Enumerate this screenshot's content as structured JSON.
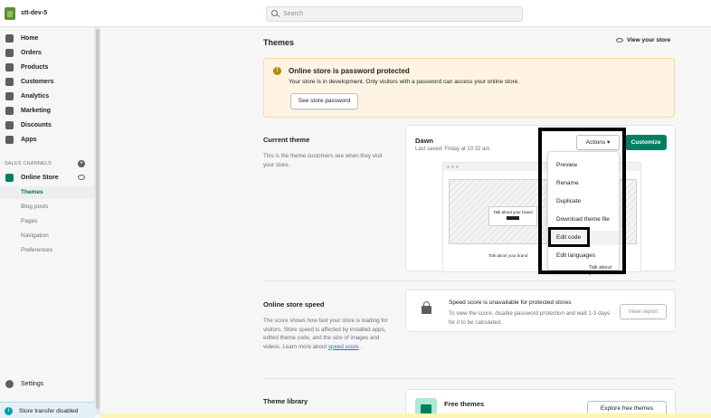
{
  "store": {
    "name": "stt-dev-5"
  },
  "search": {
    "placeholder": "Search"
  },
  "sidebar": {
    "items": [
      {
        "label": "Home"
      },
      {
        "label": "Orders"
      },
      {
        "label": "Products"
      },
      {
        "label": "Customers"
      },
      {
        "label": "Analytics"
      },
      {
        "label": "Marketing"
      },
      {
        "label": "Discounts"
      },
      {
        "label": "Apps"
      }
    ],
    "section_title": "SALES CHANNELS",
    "online_store": "Online Store",
    "sub_items": [
      {
        "label": "Themes"
      },
      {
        "label": "Blog posts"
      },
      {
        "label": "Pages"
      },
      {
        "label": "Navigation"
      },
      {
        "label": "Preferences"
      }
    ],
    "settings": "Settings",
    "transfer": "Store transfer disabled"
  },
  "page": {
    "title": "Themes",
    "view_store": "View your store"
  },
  "banner": {
    "title": "Online store is password protected",
    "text": "Your store is in development. Only visitors with a password can access your online store.",
    "button": "See store password"
  },
  "current_theme": {
    "title": "Current theme",
    "description": "This is the theme customers see when they visit your store.",
    "name": "Dawn",
    "saved": "Last saved: Friday at 10:32 am",
    "actions_label": "Actions",
    "customize_label": "Customize",
    "preview_text_1": "Talk about your brand",
    "preview_text_2": "Talk about your brand",
    "preview_text_3": "Talk about you"
  },
  "actions_menu": [
    {
      "label": "Preview"
    },
    {
      "label": "Rename"
    },
    {
      "label": "Duplicate"
    },
    {
      "label": "Download theme file"
    },
    {
      "label": "Edit code"
    },
    {
      "label": "Edit languages"
    }
  ],
  "speed": {
    "title": "Online store speed",
    "description": "The score shows how fast your store is loading for visitors. Store speed is affected by installed apps, edited theme code, and the size of images and videos. Learn more about",
    "link": "speed score",
    "card_title": "Speed score is unavailable for protected stores",
    "card_desc": "To view the score, disable password protection and wait 1-3 days for it to be calculated.",
    "button": "View report"
  },
  "library": {
    "title": "Theme library",
    "free_title": "Free themes",
    "explore": "Explore free themes"
  }
}
